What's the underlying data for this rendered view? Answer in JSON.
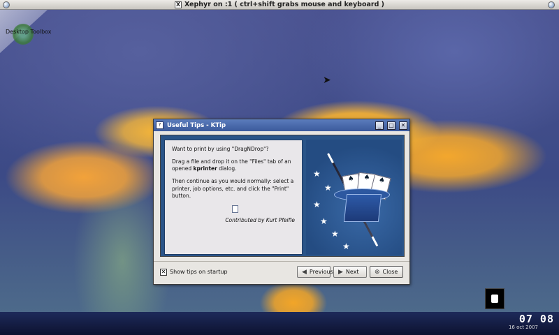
{
  "host_window": {
    "title": "Xephyr on :1 ( ctrl+shift grabs mouse and keyboard )"
  },
  "desktop": {
    "toolbox_label": "Desktop Toolbox"
  },
  "dialog": {
    "title": "Useful Tips - KTip",
    "tip": {
      "heading": "Want to print by using \"DragNDrop\"?",
      "line1_pre": "Drag a file and drop it on the \"Files\" tab of an opened ",
      "line1_bold": "kprinter",
      "line1_post": " dialog.",
      "line2": "Then continue as you would normally: select a printer, job options, etc. and click the \"Print\" button.",
      "credit": "Contributed by Kurt Pfeifle"
    },
    "show_tips_label": "Show tips on startup",
    "show_tips_checked": true,
    "buttons": {
      "previous": "Previous",
      "next": "Next",
      "close": "Close"
    }
  },
  "taskbar": {
    "clock_time": "07 08",
    "clock_date": "16 oct 2007"
  }
}
